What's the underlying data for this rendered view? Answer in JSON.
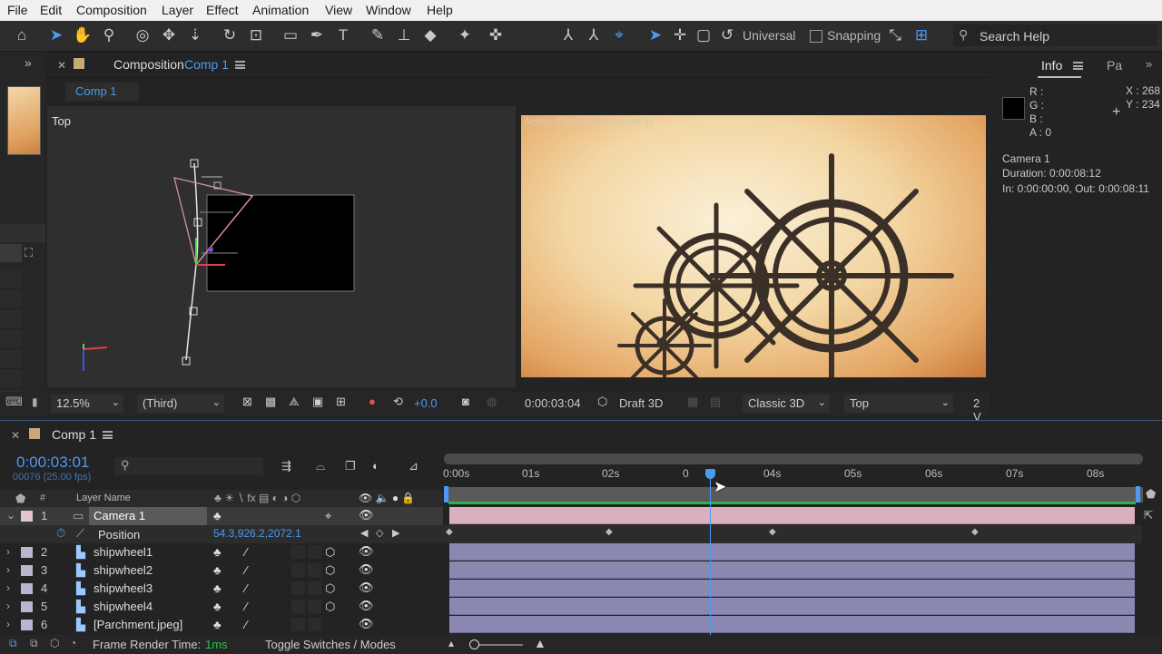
{
  "menu": [
    "File",
    "Edit",
    "Composition",
    "Layer",
    "Effect",
    "Animation",
    "View",
    "Window",
    "Help"
  ],
  "toolbar": {
    "axis_mode": "Universal",
    "snapping_label": "Snapping",
    "search_placeholder": "Search Help"
  },
  "composition_panel": {
    "title": "Composition",
    "comp_name": "Comp 1",
    "breadcrumb": "Comp 1",
    "left_view_label": "Top",
    "right_view_label": "Active Camera (Camera 1)",
    "zoom": "12.5%",
    "view_select": "(Third)",
    "exposure": "+0.0",
    "timecode": "0:00:03:04",
    "renderer": "Draft 3D",
    "renderer_select": "Classic 3D",
    "view_dropdown": "Top",
    "views_count": "2 V"
  },
  "info_panel": {
    "tab_info": "Info",
    "tab_other": "Pa",
    "r": "R :",
    "g": "G :",
    "b": "B :",
    "a": "A :  0",
    "x": "X : 268",
    "y": "Y : 234",
    "layer": "Camera 1",
    "duration": "Duration: 0:00:08:12",
    "inout": "In: 0:00:00:00, Out: 0:00:08:11"
  },
  "timeline": {
    "tab": "Comp 1",
    "current_time": "0:00:03:01",
    "frame_info": "00076 (25.00 fps)",
    "col_layer_name": "Layer Name",
    "col_hash": "#",
    "ruler_ticks": [
      "0:00s",
      "01s",
      "02s",
      "0",
      "04s",
      "05s",
      "06s",
      "07s",
      "08s"
    ],
    "playhead_fraction": 0.38,
    "layers": [
      {
        "num": "1",
        "name": "Camera 1",
        "color": "#e3c5cf"
      },
      {
        "num": "2",
        "name": "shipwheel1",
        "color": "#b7b7d2"
      },
      {
        "num": "3",
        "name": "shipwheel2",
        "color": "#b7b7d2"
      },
      {
        "num": "4",
        "name": "shipwheel3",
        "color": "#b7b7d2"
      },
      {
        "num": "5",
        "name": "shipwheel4",
        "color": "#b7b7d2"
      },
      {
        "num": "6",
        "name": "[Parchment.jpeg]",
        "color": "#b7b7d2"
      }
    ],
    "position_prop": "Position",
    "position_value": "54.3,926.2,2072.1",
    "frame_render_label": "Frame Render Time:",
    "frame_render_value": "1ms",
    "toggle_label": "Toggle Switches / Modes"
  },
  "colors": {
    "accent": "#4a9bf1",
    "layer_bar": "#8a88b0",
    "camera_bar": "#d9b0bf",
    "work_area": "#2bb34a"
  }
}
